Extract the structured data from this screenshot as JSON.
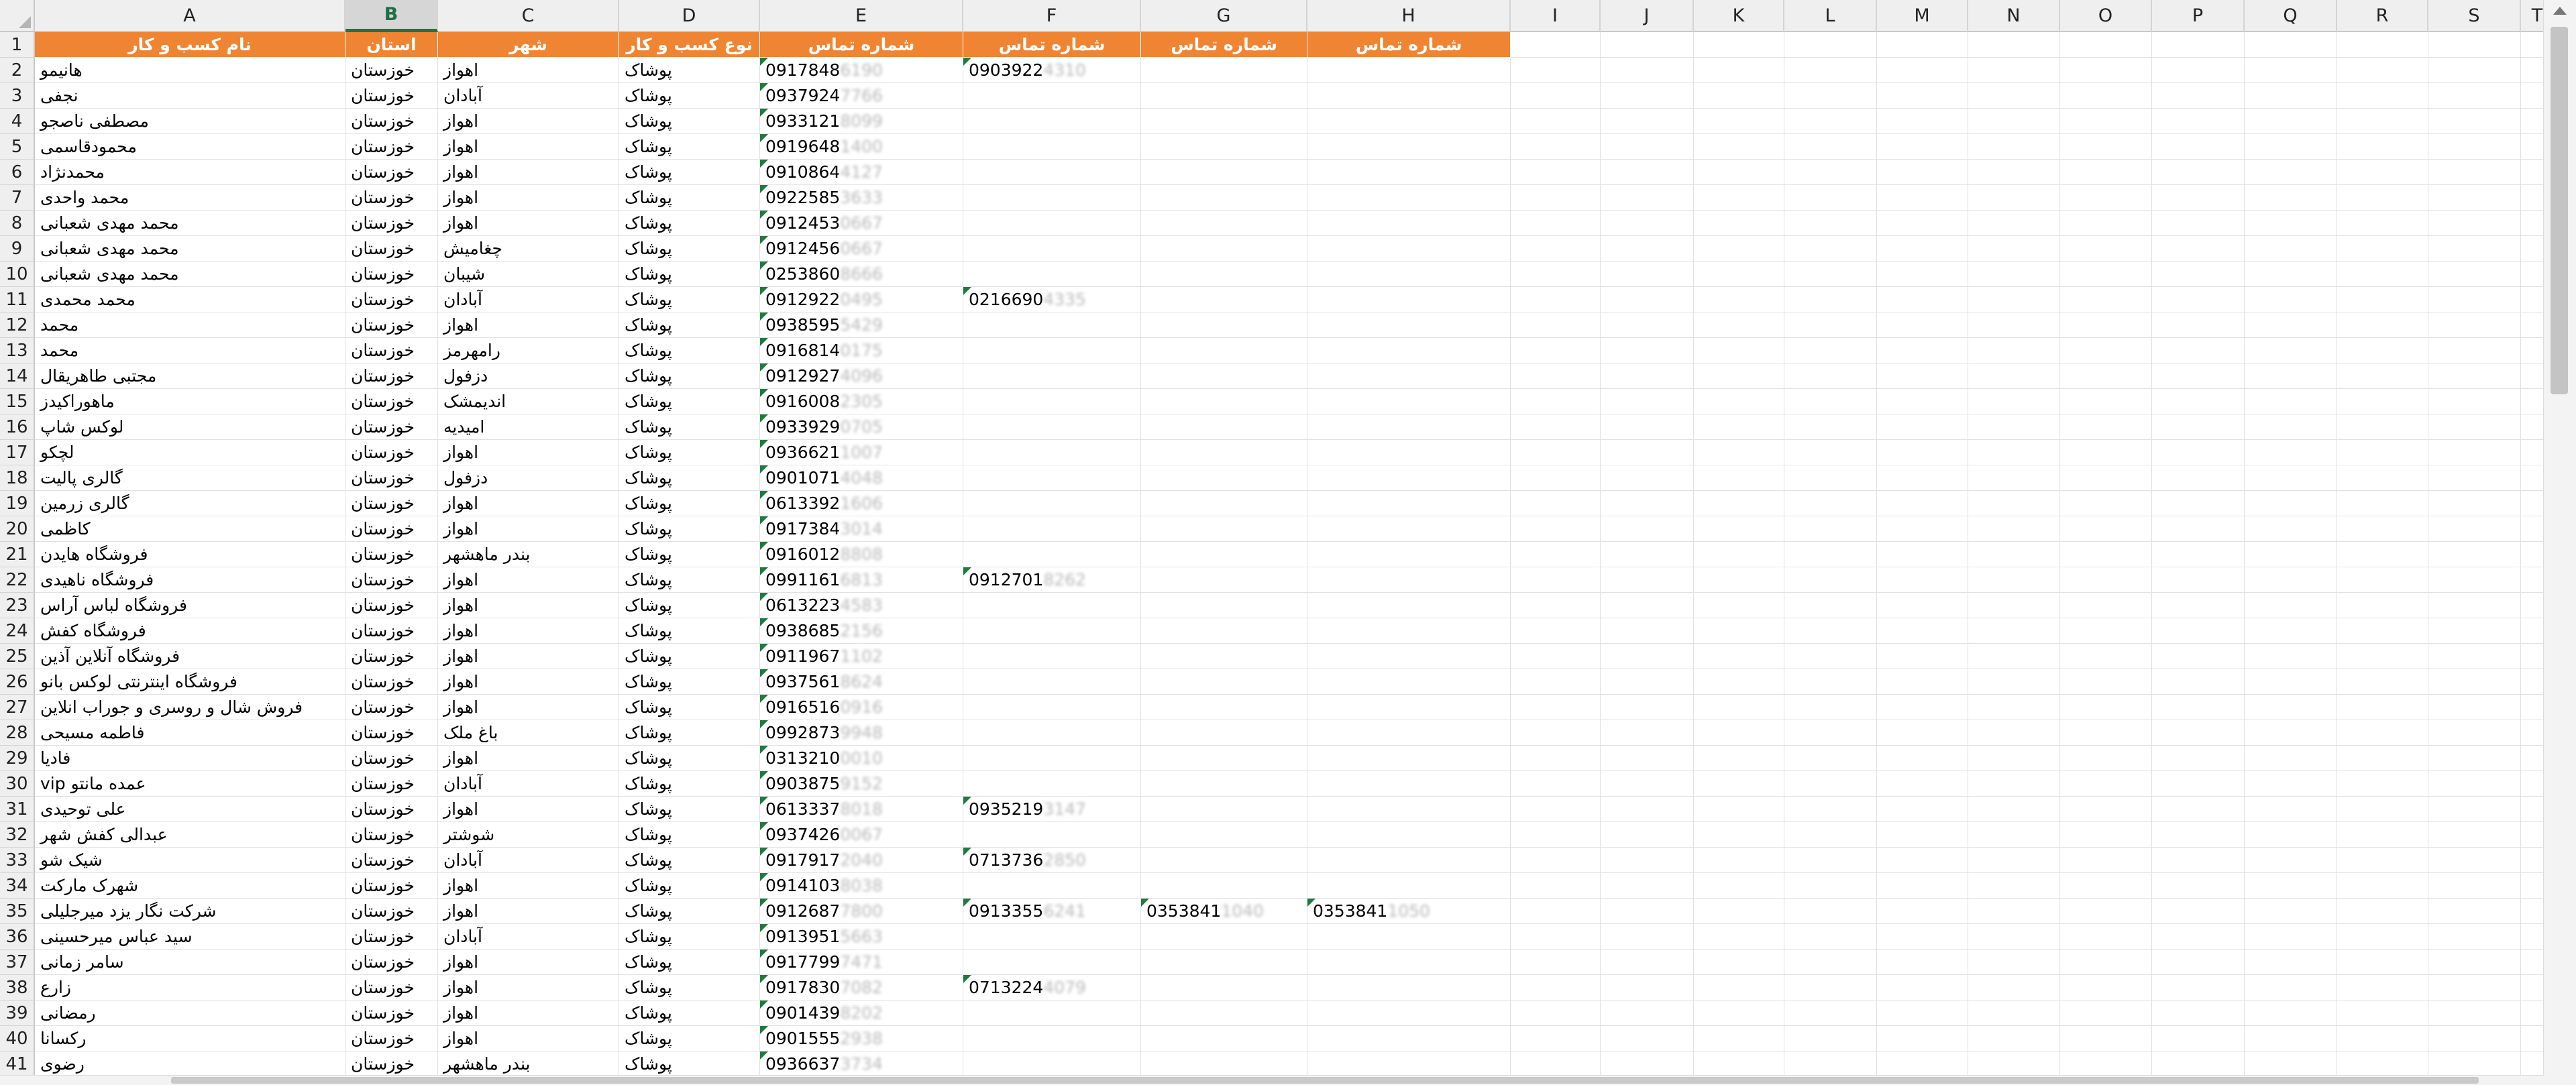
{
  "columns": [
    "A",
    "B",
    "C",
    "D",
    "E",
    "F",
    "G",
    "H",
    "I",
    "J",
    "K",
    "L",
    "M",
    "N",
    "O",
    "P",
    "Q",
    "R",
    "S",
    "T"
  ],
  "selected_column": "B",
  "header_row": {
    "row": "1",
    "A": "نام کسب و کار",
    "B": "استان",
    "C": "شهر",
    "D": "نوع کسب و کار",
    "E": "شماره تماس",
    "F": "شماره تماس",
    "G": "شماره تماس",
    "H": "شماره تماس"
  },
  "rows": [
    {
      "n": "2",
      "name": "هانیمو",
      "province": "خوزستان",
      "city": "اهواز",
      "type": "پوشاک",
      "phone": "0917848",
      "phone_hidden": "6190",
      "f": "0903922",
      "f_hidden": "4310"
    },
    {
      "n": "3",
      "name": "نجفی",
      "province": "خوزستان",
      "city": "آبادان",
      "type": "پوشاک",
      "phone": "0937924",
      "phone_hidden": "7766"
    },
    {
      "n": "4",
      "name": "مصطفی ناصجو",
      "province": "خوزستان",
      "city": "اهواز",
      "type": "پوشاک",
      "phone": "0933121",
      "phone_hidden": "8099"
    },
    {
      "n": "5",
      "name": "محمودقاسمی",
      "province": "خوزستان",
      "city": "اهواز",
      "type": "پوشاک",
      "phone": "0919648",
      "phone_hidden": "1400"
    },
    {
      "n": "6",
      "name": "محمدنژاد",
      "province": "خوزستان",
      "city": "اهواز",
      "type": "پوشاک",
      "phone": "0910864",
      "phone_hidden": "4127"
    },
    {
      "n": "7",
      "name": "محمد واحدی",
      "province": "خوزستان",
      "city": "اهواز",
      "type": "پوشاک",
      "phone": "0922585",
      "phone_hidden": "3633"
    },
    {
      "n": "8",
      "name": "محمد مهدی شعبانی",
      "province": "خوزستان",
      "city": "اهواز",
      "type": "پوشاک",
      "phone": "0912453",
      "phone_hidden": "0667"
    },
    {
      "n": "9",
      "name": "محمد مهدی شعبانی",
      "province": "خوزستان",
      "city": "چغامیش",
      "type": "پوشاک",
      "phone": "0912456",
      "phone_hidden": "0667"
    },
    {
      "n": "10",
      "name": "محمد مهدی شعبانی",
      "province": "خوزستان",
      "city": "شیبان",
      "type": "پوشاک",
      "phone": "0253860",
      "phone_hidden": "8666"
    },
    {
      "n": "11",
      "name": "محمد محمدی",
      "province": "خوزستان",
      "city": "آبادان",
      "type": "پوشاک",
      "phone": "0912922",
      "phone_hidden": "0495",
      "f": "0216690",
      "f_hidden": "4335"
    },
    {
      "n": "12",
      "name": "محمد",
      "province": "خوزستان",
      "city": "اهواز",
      "type": "پوشاک",
      "phone": "0938595",
      "phone_hidden": "5429"
    },
    {
      "n": "13",
      "name": "محمد",
      "province": "خوزستان",
      "city": "رامهرمز",
      "type": "پوشاک",
      "phone": "0916814",
      "phone_hidden": "0175"
    },
    {
      "n": "14",
      "name": "مجتبی طاهریقال",
      "province": "خوزستان",
      "city": "دزفول",
      "type": "پوشاک",
      "phone": "0912927",
      "phone_hidden": "4096"
    },
    {
      "n": "15",
      "name": "ماهوراکیدز",
      "province": "خوزستان",
      "city": "اندیمشک",
      "type": "پوشاک",
      "phone": "0916008",
      "phone_hidden": "2305"
    },
    {
      "n": "16",
      "name": "لوکس شاپ",
      "province": "خوزستان",
      "city": "امیدیه",
      "type": "پوشاک",
      "phone": "0933929",
      "phone_hidden": "0705"
    },
    {
      "n": "17",
      "name": "لچکو",
      "province": "خوزستان",
      "city": "اهواز",
      "type": "پوشاک",
      "phone": "0936621",
      "phone_hidden": "1007"
    },
    {
      "n": "18",
      "name": "گالری پالیت",
      "province": "خوزستان",
      "city": "دزفول",
      "type": "پوشاک",
      "phone": "0901071",
      "phone_hidden": "4048"
    },
    {
      "n": "19",
      "name": "گالری زرمین",
      "province": "خوزستان",
      "city": "اهواز",
      "type": "پوشاک",
      "phone": "0613392",
      "phone_hidden": "1606"
    },
    {
      "n": "20",
      "name": "کاظمی",
      "province": "خوزستان",
      "city": "اهواز",
      "type": "پوشاک",
      "phone": "0917384",
      "phone_hidden": "3014"
    },
    {
      "n": "21",
      "name": "فروشگاه هایدن",
      "province": "خوزستان",
      "city": "بندر ماهشهر",
      "type": "پوشاک",
      "phone": "0916012",
      "phone_hidden": "8808"
    },
    {
      "n": "22",
      "name": "فروشگاه ناهیدی",
      "province": "خوزستان",
      "city": "اهواز",
      "type": "پوشاک",
      "phone": "0991161",
      "phone_hidden": "6813",
      "f": "0912701",
      "f_hidden": "8262"
    },
    {
      "n": "23",
      "name": "فروشگاه لباس آراس",
      "province": "خوزستان",
      "city": "اهواز",
      "type": "پوشاک",
      "phone": "0613223",
      "phone_hidden": "4583"
    },
    {
      "n": "24",
      "name": "فروشگاه کفش",
      "province": "خوزستان",
      "city": "اهواز",
      "type": "پوشاک",
      "phone": "0938685",
      "phone_hidden": "2156"
    },
    {
      "n": "25",
      "name": "فروشگاه آنلاین آذین",
      "province": "خوزستان",
      "city": "اهواز",
      "type": "پوشاک",
      "phone": "0911967",
      "phone_hidden": "1102"
    },
    {
      "n": "26",
      "name": "فروشگاه اینترنتی لوکس بانو",
      "province": "خوزستان",
      "city": "اهواز",
      "type": "پوشاک",
      "phone": "0937561",
      "phone_hidden": "8624"
    },
    {
      "n": "27",
      "name": "فروش شال و روسری و جوراب انلاین",
      "province": "خوزستان",
      "city": "اهواز",
      "type": "پوشاک",
      "phone": "0916516",
      "phone_hidden": "0916"
    },
    {
      "n": "28",
      "name": "فاطمه مسیحی",
      "province": "خوزستان",
      "city": "باغ ملک",
      "type": "پوشاک",
      "phone": "0992873",
      "phone_hidden": "9948"
    },
    {
      "n": "29",
      "name": "فادیا",
      "province": "خوزستان",
      "city": "اهواز",
      "type": "پوشاک",
      "phone": "0313210",
      "phone_hidden": "0010"
    },
    {
      "n": "30",
      "name": "عمده مانتو vip",
      "province": "خوزستان",
      "city": "آبادان",
      "type": "پوشاک",
      "phone": "0903875",
      "phone_hidden": "9152"
    },
    {
      "n": "31",
      "name": "علی توحیدی",
      "province": "خوزستان",
      "city": "اهواز",
      "type": "پوشاک",
      "phone": "0613337",
      "phone_hidden": "8018",
      "f": "0935219",
      "f_hidden": "3147"
    },
    {
      "n": "32",
      "name": "عبدالی کفش شهر",
      "province": "خوزستان",
      "city": "شوشتر",
      "type": "پوشاک",
      "phone": "0937426",
      "phone_hidden": "0067"
    },
    {
      "n": "33",
      "name": "شیک شو",
      "province": "خوزستان",
      "city": "آبادان",
      "type": "پوشاک",
      "phone": "0917917",
      "phone_hidden": "2040",
      "f": "0713736",
      "f_hidden": "2850"
    },
    {
      "n": "34",
      "name": "شهرک مارکت",
      "province": "خوزستان",
      "city": "اهواز",
      "type": "پوشاک",
      "phone": "0914103",
      "phone_hidden": "8038"
    },
    {
      "n": "35",
      "name": "شرکت نگار یزد  میرجلیلی",
      "province": "خوزستان",
      "city": "اهواز",
      "type": "پوشاک",
      "phone": "0912687",
      "phone_hidden": "7800",
      "f": "0913355",
      "f_hidden": "6241",
      "g": "0353841",
      "g_hidden": "1040",
      "h": "0353841",
      "h_hidden": "1050"
    },
    {
      "n": "36",
      "name": "سید عباس میرحسینی",
      "province": "خوزستان",
      "city": "آبادان",
      "type": "پوشاک",
      "phone": "0913951",
      "phone_hidden": "5663"
    },
    {
      "n": "37",
      "name": "سامر زمانی",
      "province": "خوزستان",
      "city": "اهواز",
      "type": "پوشاک",
      "phone": "0917799",
      "phone_hidden": "7471"
    },
    {
      "n": "38",
      "name": "زارع",
      "province": "خوزستان",
      "city": "اهواز",
      "type": "پوشاک",
      "phone": "0917830",
      "phone_hidden": "7082",
      "f": "0713224",
      "f_hidden": "4079"
    },
    {
      "n": "39",
      "name": "رمضانی",
      "province": "خوزستان",
      "city": "اهواز",
      "type": "پوشاک",
      "phone": "0901439",
      "phone_hidden": "8202"
    },
    {
      "n": "40",
      "name": "رکسانا",
      "province": "خوزستان",
      "city": "اهواز",
      "type": "پوشاک",
      "phone": "0901555",
      "phone_hidden": "2938"
    },
    {
      "n": "41",
      "name": "رضوی",
      "province": "خوزستان",
      "city": "بندر ماهشهر",
      "type": "پوشاک",
      "phone": "0936637",
      "phone_hidden": "3734"
    }
  ],
  "colors": {
    "header_fill": "#ef8533",
    "selected_col_accent": "#217346",
    "error_indicator": "#1f7a3e"
  },
  "icons": {
    "error_indicator": "green-corner-triangle-icon",
    "select_all": "select-all-corner-icon"
  }
}
